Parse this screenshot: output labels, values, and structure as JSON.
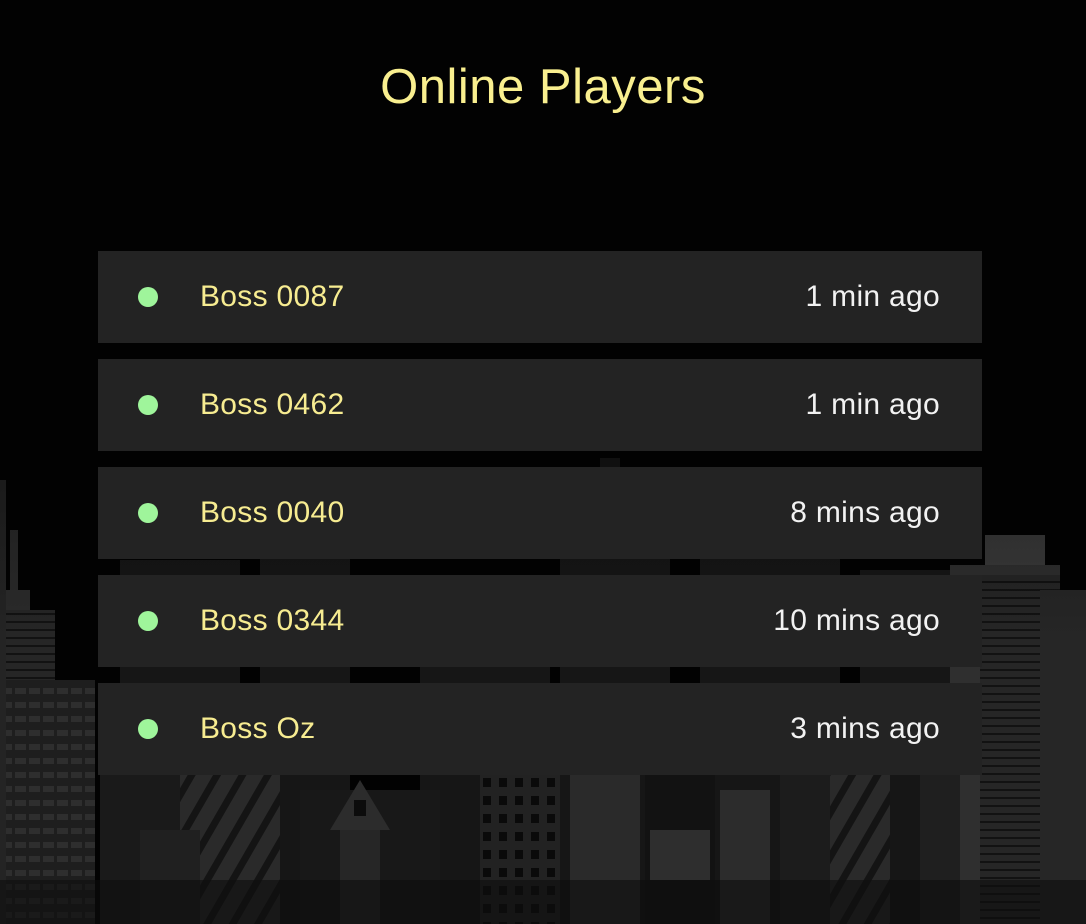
{
  "page": {
    "title": "Online Players"
  },
  "colors": {
    "background": "#020202",
    "title": "#f9ef8f",
    "player_name": "#f7ec91",
    "last_seen": "#f2f2f2",
    "row_background": "#232323",
    "online_dot": "#9ff59b",
    "skyline": "#2a2a2a"
  },
  "players": [
    {
      "name": "Boss 0087",
      "last_seen": "1 min ago",
      "status": "online",
      "status_icon": "online-dot-icon"
    },
    {
      "name": "Boss 0462",
      "last_seen": "1 min ago",
      "status": "online",
      "status_icon": "online-dot-icon"
    },
    {
      "name": "Boss 0040",
      "last_seen": "8 mins ago",
      "status": "online",
      "status_icon": "online-dot-icon"
    },
    {
      "name": "Boss 0344",
      "last_seen": "10 mins ago",
      "status": "online",
      "status_icon": "online-dot-icon"
    },
    {
      "name": "Boss Oz",
      "last_seen": "3 mins ago",
      "status": "online",
      "status_icon": "online-dot-icon"
    }
  ]
}
